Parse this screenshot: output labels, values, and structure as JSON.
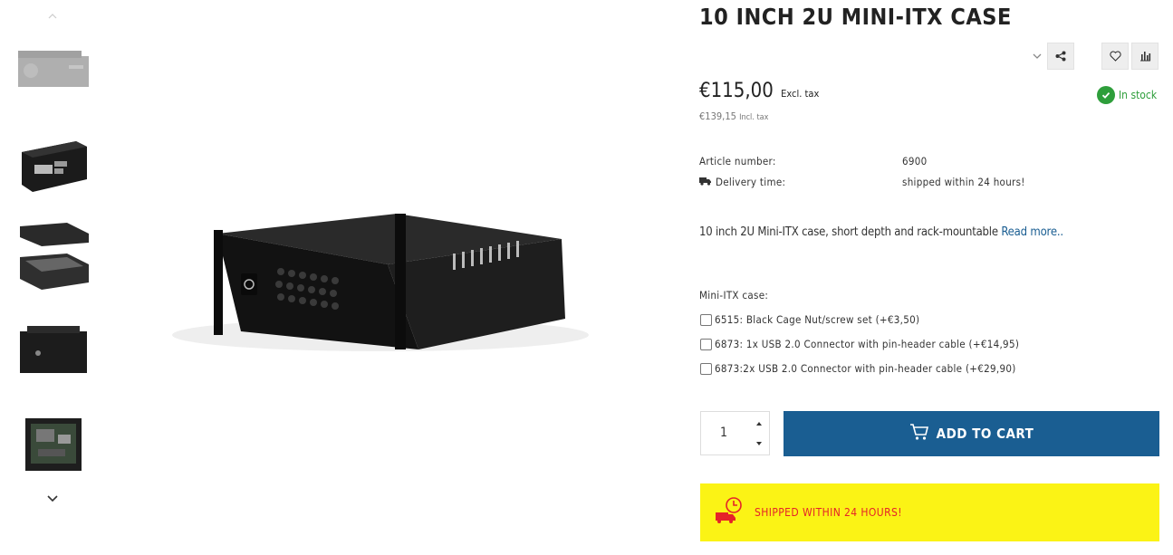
{
  "gallery": {
    "thumbnails": [
      "thumb-front-grey",
      "thumb-rear-ports",
      "thumb-exploded",
      "thumb-front-bezel",
      "thumb-open-top"
    ],
    "up_icon": "chevron-up-icon",
    "down_icon": "chevron-down-icon"
  },
  "product": {
    "title": "10 INCH 2U MINI-ITX CASE",
    "price": "€115,00",
    "price_excl_label": "Excl. tax",
    "price_incl": "€139,15",
    "price_incl_label": "Incl. tax",
    "stock": "In stock",
    "specs": {
      "article_label": "Article number:",
      "article_value": "6900",
      "delivery_label": "Delivery time:",
      "delivery_value": "shipped within 24 hours!"
    },
    "description": "10 inch 2U Mini-ITX case, short depth and rack-mountable",
    "read_more": "Read more.."
  },
  "options": {
    "heading": "Mini-ITX case:",
    "items": [
      "6515: Black Cage Nut/screw set (+€3,50)",
      "6873: 1x USB 2.0 Connector with pin-header cable (+€14,95)",
      "6873:2x USB 2.0 Connector with pin-header cable (+€29,90)"
    ]
  },
  "cart": {
    "quantity": "1",
    "add_label": "ADD TO CART"
  },
  "banner": {
    "text": "SHIPPED WITHIN 24 HOURS!"
  },
  "colors": {
    "accent_blue": "#1a5e92",
    "stock_green": "#2e9e3b",
    "banner_yellow": "#fbf315",
    "banner_red": "#e52329"
  }
}
